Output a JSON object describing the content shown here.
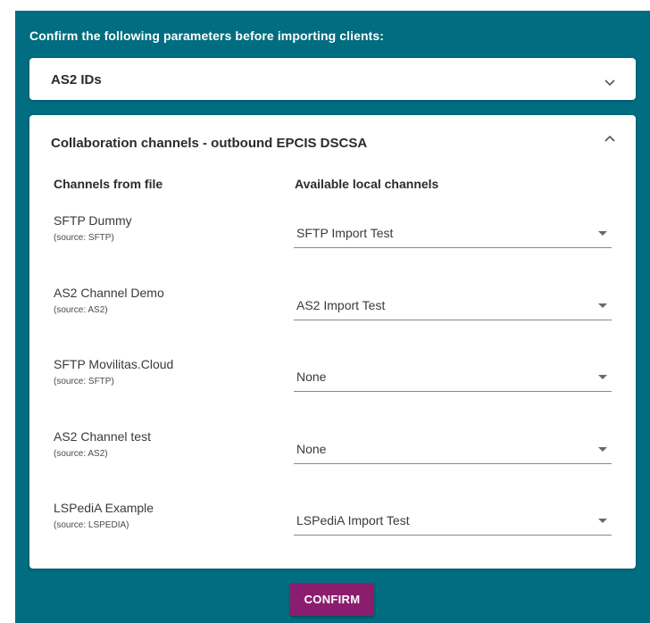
{
  "panel": {
    "title": "Confirm the following parameters before importing clients:"
  },
  "as2_ids": {
    "title": "AS2 IDs",
    "icon": "chevron-down-icon"
  },
  "collab": {
    "title": "Collaboration channels - outbound EPCIS DSCSA",
    "icon": "chevron-up-icon",
    "col_left": "Channels from file",
    "col_right": "Available local channels",
    "rows": [
      {
        "name": "SFTP Dummy",
        "source": "(source: SFTP)",
        "selected": "SFTP Import Test"
      },
      {
        "name": "AS2 Channel Demo",
        "source": "(source: AS2)",
        "selected": "AS2 Import Test"
      },
      {
        "name": "SFTP Movilitas.Cloud",
        "source": "(source: SFTP)",
        "selected": "None"
      },
      {
        "name": "AS2 Channel test",
        "source": "(source: AS2)",
        "selected": "None"
      },
      {
        "name": "LSPediA Example",
        "source": "(source: LSPEDIA)",
        "selected": "LSPediA Import Test"
      }
    ]
  },
  "confirm_label": "CONFIRM",
  "colors": {
    "panel_bg": "#006e80",
    "confirm_bg": "#8b1d6e"
  }
}
